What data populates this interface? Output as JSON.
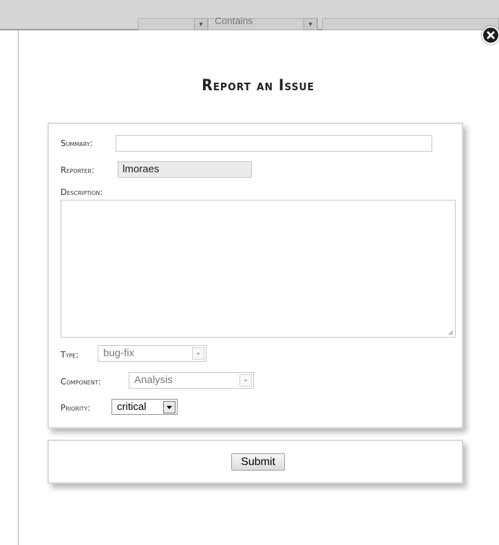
{
  "background": {
    "filter_operator": "Contains"
  },
  "modal": {
    "title": "Report an Issue",
    "close_icon": "close-icon"
  },
  "form": {
    "summary": {
      "label": "Summary:",
      "value": ""
    },
    "reporter": {
      "label": "Reporter:",
      "value": "lmoraes"
    },
    "description": {
      "label": "Description:",
      "value": ""
    },
    "type": {
      "label": "Type:",
      "selected": "bug-fix",
      "disabled": true
    },
    "component": {
      "label": "Component:",
      "selected": "Analysis",
      "disabled": true
    },
    "priority": {
      "label": "Priority:",
      "selected": "critical",
      "disabled": false
    }
  },
  "actions": {
    "submit_label": "Submit"
  }
}
